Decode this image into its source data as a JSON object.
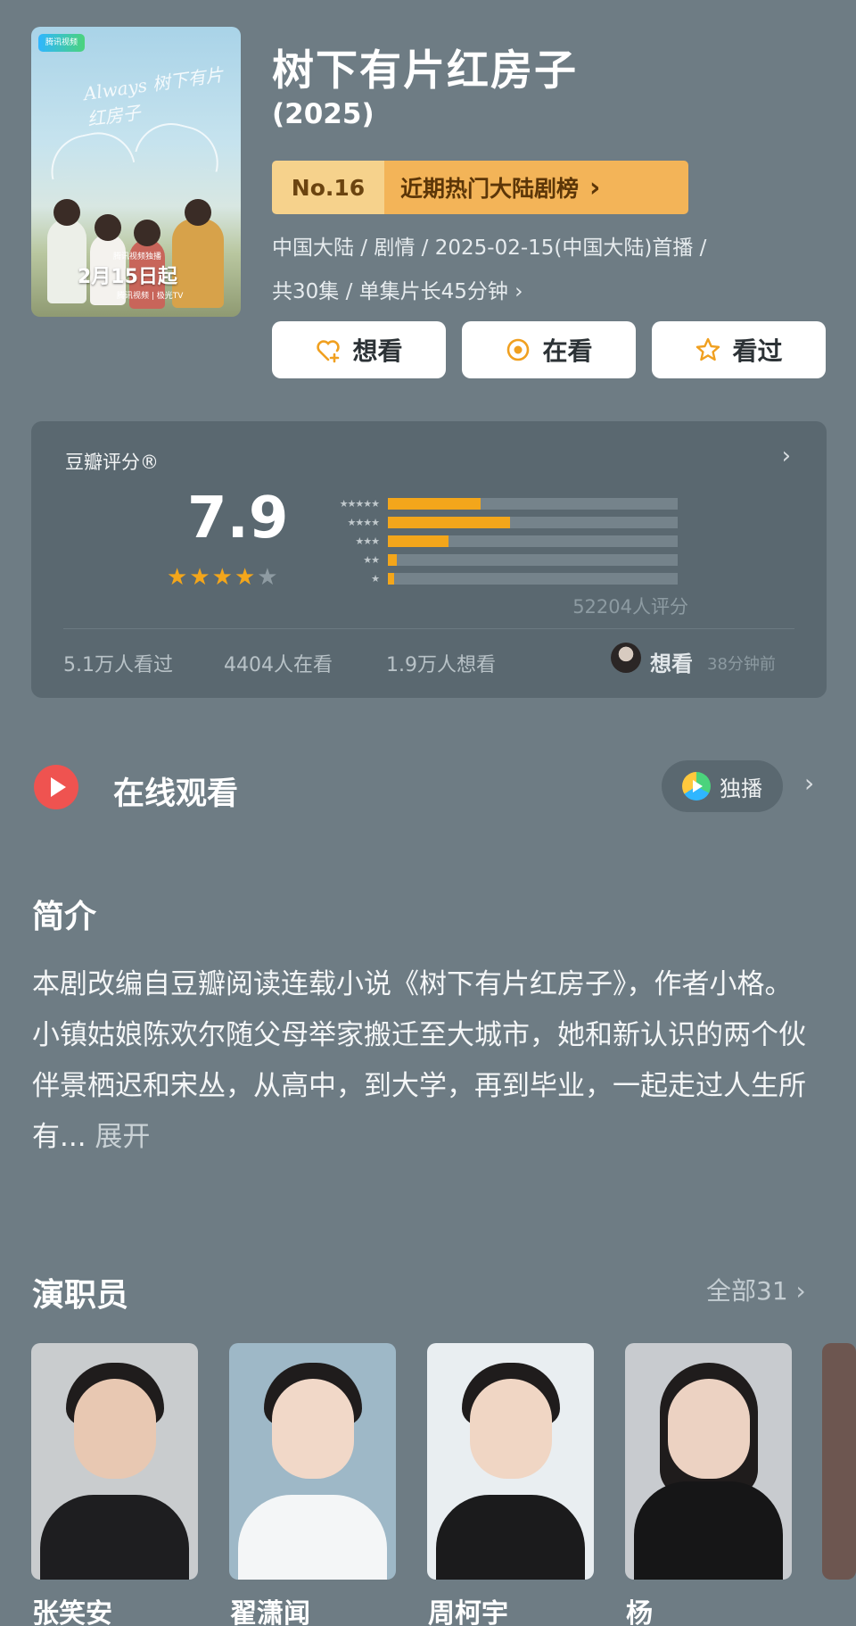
{
  "poster": {
    "brand": "腾讯视频",
    "script": "Always 树下有片红房子",
    "date": "2月15日起",
    "sub": "腾讯视频独播",
    "tv": "腾讯视频 | 极光TV"
  },
  "title": "树下有片红房子",
  "year": "(2025)",
  "rank": {
    "number": "No.16",
    "label": "近期热门大陆剧榜",
    "chevron": "›"
  },
  "meta": {
    "line1": "中国大陆 / 剧情 / 2025-02-15(中国大陆)首播 /",
    "line2": "共30集 / 单集片长45分钟 ›"
  },
  "actions": {
    "want": "想看",
    "watching": "在看",
    "watched": "看过"
  },
  "rating": {
    "label": "豆瓣评分®",
    "chevron": "›",
    "score": "7.9",
    "stars_filled": 4,
    "distribution": [
      {
        "stars": "★★★★★",
        "value": 0.32
      },
      {
        "stars": "★★★★",
        "value": 0.42
      },
      {
        "stars": "★★★",
        "value": 0.21
      },
      {
        "stars": "★★",
        "value": 0.03
      },
      {
        "stars": "★",
        "value": 0.02
      }
    ],
    "count": "52204人评分",
    "watched": "5.1万人看过",
    "watching": "4404人在看",
    "want": "1.9万人想看",
    "friend_action": "想看",
    "friend_time": "38分钟前",
    "colors": {
      "fill": "#f3a61b",
      "track": "#75838b"
    }
  },
  "online": {
    "title": "在线观看",
    "badge": "独播",
    "chevron": "›"
  },
  "intro": {
    "heading": "简介",
    "text": "本剧改编自豆瓣阅读连载小说《树下有片红房子》，作者小格。小镇姑娘陈欢尔随父母举家搬迁至大城市，她和新认识的两个伙伴景栖迟和宋丛，从高中，到大学，再到毕业，一起走过人生所有...",
    "more": "展开"
  },
  "cast": {
    "heading": "演职员",
    "all": "全部31 ›",
    "members": [
      {
        "name": "张笑安"
      },
      {
        "name": "翟潇闻"
      },
      {
        "name": "周柯宇"
      },
      {
        "name": "杨"
      }
    ]
  }
}
